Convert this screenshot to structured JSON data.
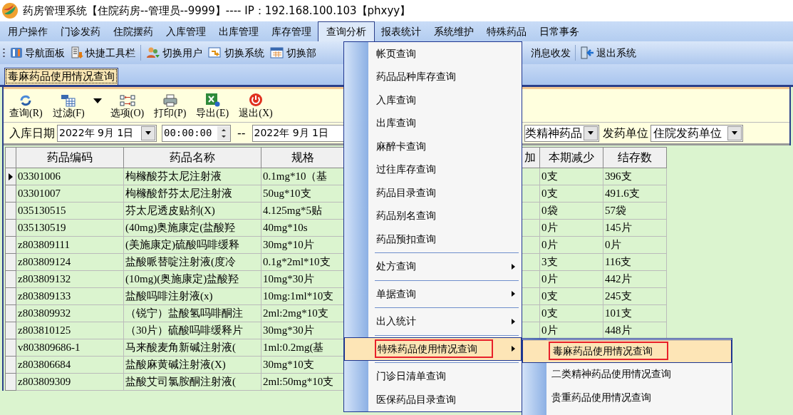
{
  "window": {
    "title": "药房管理系统【住院药房--管理员--9999】---- IP：192.168.100.103【phxyy】"
  },
  "menubar": [
    {
      "label": "用户操作",
      "selected": false
    },
    {
      "label": "门诊发药",
      "selected": false
    },
    {
      "label": "住院摆药",
      "selected": false
    },
    {
      "label": "入库管理",
      "selected": false
    },
    {
      "label": "出库管理",
      "selected": false
    },
    {
      "label": "库存管理",
      "selected": false
    },
    {
      "label": "查询分析",
      "selected": true
    },
    {
      "label": "报表统计",
      "selected": false
    },
    {
      "label": "系统维护",
      "selected": false
    },
    {
      "label": "特殊药品",
      "selected": false
    },
    {
      "label": "日常事务",
      "selected": false
    }
  ],
  "toolbar_left": [
    {
      "kind": "panel",
      "label": "导航面板"
    },
    {
      "kind": "tools",
      "label": "快捷工具栏"
    },
    {
      "kind": "separator"
    },
    {
      "kind": "users",
      "label": "切换用户"
    },
    {
      "kind": "switch",
      "label": "切换系统"
    },
    {
      "kind": "calendar",
      "label": "切换部"
    }
  ],
  "toolbar_right": [
    {
      "kind": "message",
      "label": "消息收发"
    },
    {
      "kind": "separator"
    },
    {
      "kind": "exit",
      "label": "退出系统"
    }
  ],
  "document_tab": {
    "label": "毒麻药品使用情况查询",
    "selected": true
  },
  "actions": [
    {
      "kind": "refresh",
      "label": "查询(R)"
    },
    {
      "kind": "filter",
      "label": "过滤(F)"
    },
    {
      "kind": "dropdown"
    },
    {
      "kind": "options",
      "label": "选项(O)"
    },
    {
      "kind": "print",
      "label": "打印(P)"
    },
    {
      "kind": "excel",
      "label": "导出(E)"
    },
    {
      "kind": "power",
      "label": "退出(X)"
    }
  ],
  "filter": {
    "date_label": "入库日期",
    "date_from": "2022年 9月 1日",
    "time_from": "00:00:00",
    "range_separator": "--",
    "date_to": "2022年 9月 1日",
    "category": "类精神药品",
    "unit_label": "发药单位",
    "unit": "住院发药单位"
  },
  "table": {
    "columns": [
      "药品编码",
      "药品名称",
      "规格",
      "加",
      "本期减少",
      "结存数"
    ],
    "rows": [
      {
        "current": true,
        "cells": [
          "03301006",
          "枸橼酸芬太尼注射液",
          "0.1mg*10（基",
          "0支",
          "396支"
        ]
      },
      {
        "current": false,
        "cells": [
          "03301007",
          "枸橼酸舒芬太尼注射液",
          "50ug*10支",
          "0支",
          "491.6支"
        ]
      },
      {
        "current": false,
        "cells": [
          "035130515",
          "芬太尼透皮贴剂(X)",
          "4.125mg*5贴",
          "0袋",
          "57袋"
        ]
      },
      {
        "current": false,
        "cells": [
          "035130519",
          "(40mg)奥施康定(盐酸羟",
          "40mg*10s",
          "0片",
          "145片"
        ]
      },
      {
        "current": false,
        "cells": [
          "z803809111",
          "(美施康定)硫酸吗啡缓释",
          "30mg*10片",
          "0片",
          "0片"
        ]
      },
      {
        "current": false,
        "cells": [
          "z803809124",
          "盐酸哌替啶注射液(度冷",
          "0.1g*2ml*10支",
          "3支",
          "116支"
        ]
      },
      {
        "current": false,
        "cells": [
          "z803809132",
          "(10mg)(奥施康定)盐酸羟",
          "10mg*30片",
          "0片",
          "442片"
        ]
      },
      {
        "current": false,
        "cells": [
          "z803809133",
          "盐酸吗啡注射液(x)",
          "10mg:1ml*10支",
          "0支",
          "245支"
        ]
      },
      {
        "current": false,
        "cells": [
          "z803809932",
          "（锐宁）盐酸氢吗啡酮注",
          "2ml:2mg*10支",
          "0支",
          "101支"
        ]
      },
      {
        "current": false,
        "cells": [
          "z803810125",
          "（30片）硫酸吗啡缓释片",
          "30mg*30片",
          "0片",
          "448片"
        ]
      },
      {
        "current": false,
        "cells": [
          "v803809686-1",
          "马来酸麦角新碱注射液(",
          "1ml:0.2mg(基"
        ]
      },
      {
        "current": false,
        "cells": [
          "z803806684",
          "盐酸麻黄碱注射液(X)",
          "30mg*10支"
        ]
      },
      {
        "current": false,
        "cells": [
          "z803809309",
          "盐酸艾司氯胺酮注射液(",
          "2ml:50mg*10支"
        ]
      }
    ]
  },
  "dropdown_menu": {
    "items": [
      {
        "kind": "item",
        "label": "帐页查询",
        "selected": false
      },
      {
        "kind": "item",
        "label": "药品品种库存查询",
        "selected": false
      },
      {
        "kind": "item",
        "label": "入库查询",
        "selected": false
      },
      {
        "kind": "item",
        "label": "出库查询",
        "selected": false
      },
      {
        "kind": "item",
        "label": "麻醉卡查询",
        "selected": false
      },
      {
        "kind": "item",
        "label": "过往库存查询",
        "selected": false
      },
      {
        "kind": "item",
        "label": "药品目录查询",
        "selected": false
      },
      {
        "kind": "item",
        "label": "药品别名查询",
        "selected": false
      },
      {
        "kind": "item",
        "label": "药品预扣查询",
        "selected": false
      },
      {
        "kind": "separator"
      },
      {
        "kind": "submenu",
        "label": "处方查询",
        "selected": false
      },
      {
        "kind": "separator"
      },
      {
        "kind": "submenu",
        "label": "单据查询",
        "selected": false
      },
      {
        "kind": "separator"
      },
      {
        "kind": "submenu",
        "label": "出入统计",
        "selected": false
      },
      {
        "kind": "separator"
      },
      {
        "kind": "submenu",
        "label": "特殊药品使用情况查询",
        "selected": true
      },
      {
        "kind": "separator"
      },
      {
        "kind": "item",
        "label": "门诊日清单查询",
        "selected": false
      },
      {
        "kind": "item",
        "label": "医保药品目录查询",
        "selected": false
      }
    ]
  },
  "submenu": {
    "items": [
      {
        "label": "毒麻药品使用情况查询",
        "selected": true
      },
      {
        "label": "二类精神药品使用情况查询",
        "selected": false
      },
      {
        "label": "贵重药品使用情况查询",
        "selected": false
      }
    ]
  }
}
